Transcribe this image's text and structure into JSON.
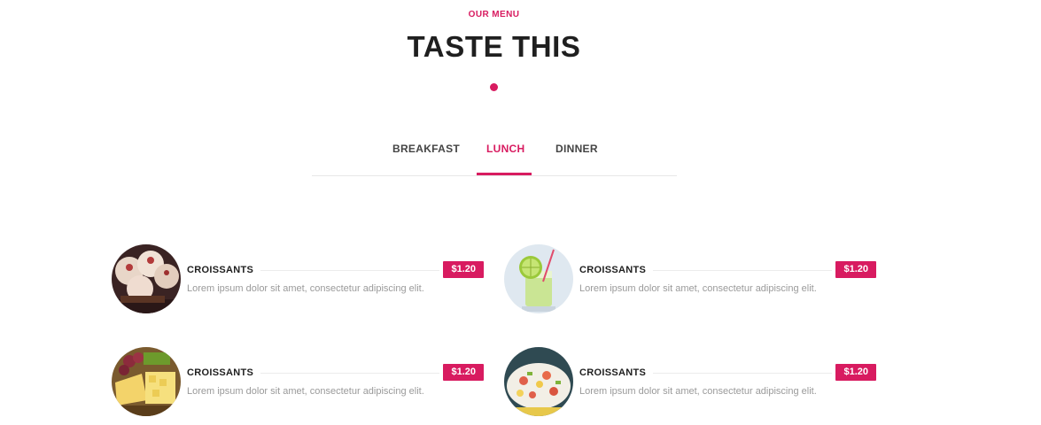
{
  "header": {
    "eyebrow": "OUR MENU",
    "title": "TASTE THIS"
  },
  "tabs": [
    {
      "label": "BREAKFAST",
      "active": false
    },
    {
      "label": "LUNCH",
      "active": true
    },
    {
      "label": "DINNER",
      "active": false
    }
  ],
  "menu": {
    "items": [
      {
        "name": "CROISSANTS",
        "price": "$1.20",
        "description": "Lorem ipsum dolor sit amet, consectetur adipiscing elit.",
        "image": "cupcakes-icon"
      },
      {
        "name": "CROISSANTS",
        "price": "$1.20",
        "description": "Lorem ipsum dolor sit amet, consectetur adipiscing elit.",
        "image": "lime-drink-icon"
      },
      {
        "name": "CROISSANTS",
        "price": "$1.20",
        "description": "Lorem ipsum dolor sit amet, consectetur adipiscing elit.",
        "image": "cheese-platter-icon"
      },
      {
        "name": "CROISSANTS",
        "price": "$1.20",
        "description": "Lorem ipsum dolor sit amet, consectetur adipiscing elit.",
        "image": "salad-icon"
      }
    ]
  },
  "colors": {
    "accent": "#d81b60",
    "heading": "#1f1f1f",
    "muted": "#9a9a9a"
  }
}
